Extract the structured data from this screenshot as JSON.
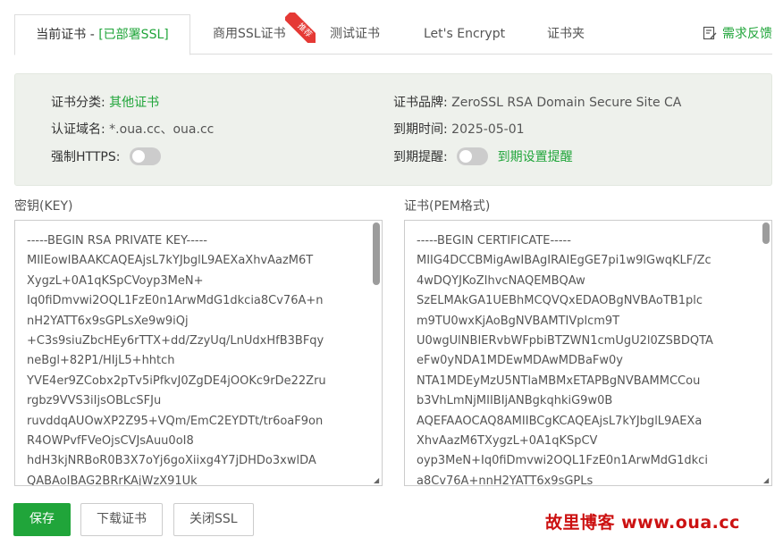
{
  "tabs": {
    "current_prefix": "当前证书 - ",
    "current_status": "[已部署SSL]",
    "commercial": "商用SSL证书",
    "recommend_badge": "推荐",
    "test": "测试证书",
    "letsencrypt": "Let's Encrypt",
    "folder": "证书夹",
    "feedback": "需求反馈"
  },
  "info": {
    "category_label": "证书分类:",
    "category_value": "其他证书",
    "brand_label": "证书品牌:",
    "brand_value": "ZeroSSL RSA Domain Secure Site CA",
    "domain_label": "认证域名:",
    "domain_value": "*.oua.cc、oua.cc",
    "expire_label": "到期时间:",
    "expire_value": "2025-05-01",
    "https_label": "强制HTTPS:",
    "https_enabled": false,
    "remind_label": "到期提醒:",
    "remind_enabled": false,
    "remind_link": "到期设置提醒"
  },
  "key_box": {
    "label": "密钥(KEY)",
    "content": "-----BEGIN RSA PRIVATE KEY-----\nMIIEowIBAAKCAQEAjsL7kYJbglL9AEXaXhvAazM6T\nXygzL+0A1qKSpCVoyp3MeN+\nIq0fiDmvwi2OQL1FzE0n1ArwMdG1dkcia8Cv76A+n\nnH2YATT6x9sGPLsXe9w9iQj\n+C3s9siuZbcHEy6rTTX+dd/ZzyUq/LnUdxHfB3BFqy\nneBgl+82P1/HIjL5+hhtch\nYVE4er9ZCobx2pTv5iPfkvJ0ZgDE4jOOKc9rDe22Zru\nrgbz9VVS3iIjsOBLcSFJu\nruvddqAUOwXP2Z95+VQm/EmC2EYDTt/tr6oaF9on\nR4OWPvfFVeOjsCVJsAuu0oI8\nhdH3kjNRBoR0B3X7oYj6goXiixg4Y7jDHDo3xwlDA\nQABAoIBAG2BRrKAjWzX91Uk"
  },
  "cert_box": {
    "label": "证书(PEM格式)",
    "content": "-----BEGIN CERTIFICATE-----\nMIIG4DCCBMigAwIBAgIRAIEgGE7pi1w9lGwqKLF/Zc\n4wDQYJKoZIhvcNAQEMBQAw\nSzELMAkGA1UEBhMCQVQxEDAOBgNVBAoTB1plc\nm9TU0wxKjAoBgNVBAMTIVplcm9T\nU0wgUlNBIERvbWFpbiBTZWN1cmUgU2l0ZSBDQTA\neFw0yNDA1MDEwMDAwMDBaFw0y\nNTA1MDEyMzU5NTlaMBMxETAPBgNVBAMMCCou\nb3VhLmNjMIIBIjANBgkqhkiG9w0B\nAQEFAAOCAQ8AMIIBCgKCAQEAjsL7kYJbglL9AEXa\nXhvAazM6TXygzL+0A1qKSpCV\noyp3MeN+Iq0fiDmvwi2OQL1FzE0n1ArwMdG1dkci\na8Cv76A+nnH2YATT6x9sGPLs"
  },
  "buttons": {
    "save": "保存",
    "download": "下载证书",
    "close_ssl": "关闭SSL"
  },
  "watermark": "故里博客 www.oua.cc",
  "colors": {
    "accent": "#20a53a",
    "badge": "#e53935",
    "watermark": "#cc1111",
    "panel_bg": "#eef1ec"
  }
}
